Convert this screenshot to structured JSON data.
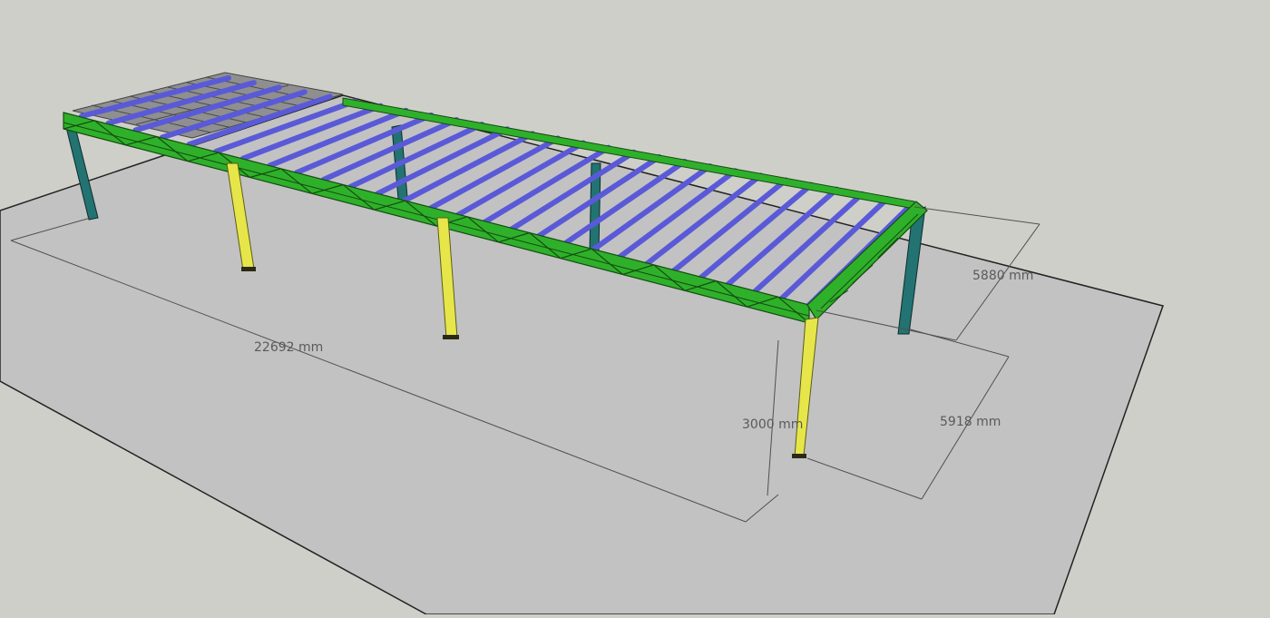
{
  "colors": {
    "sky": "#cfcfca",
    "ground": "#c2c2c2",
    "main_truss": "#2fb02a",
    "purlin": "#5a5ad8",
    "edge_column": "#237373",
    "mid_column": "#e6e64a",
    "roof_panel": "#8f8f8f",
    "dimension": "#505050"
  },
  "dimensions": {
    "length": "22692 mm",
    "depth_top": "5880 mm",
    "depth_bottom": "5918 mm",
    "height": "3000 mm"
  }
}
